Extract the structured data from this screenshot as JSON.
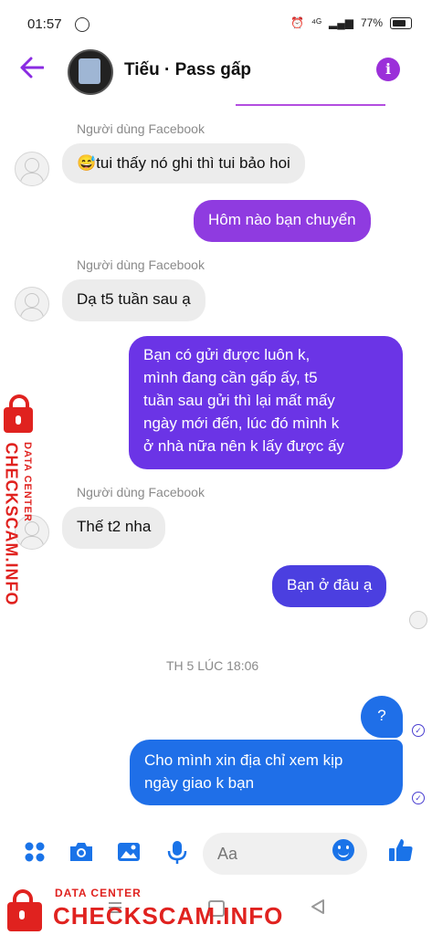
{
  "status_bar": {
    "time": "01:57",
    "signal": "⁴ᴳ",
    "battery": "77%"
  },
  "header": {
    "title": "Tiếu · Pass gấp",
    "info_icon": "i"
  },
  "messages": [
    {
      "sender": "Người dùng Facebook",
      "text": "😅tui thấy nó ghi thì tui bảo hoi"
    },
    {
      "text": "Hôm nào bạn chuyển"
    },
    {
      "sender": "Người dùng Facebook",
      "text": "Dạ t5 tuần sau ạ"
    },
    {
      "lines": [
        "Bạn có gửi được luôn k,",
        "mình đang cần gấp ấy, t5",
        "tuần sau gửi thì lại mất mấy",
        "ngày mới đến, lúc đó mình k",
        "ở nhà nữa nên k lấy được ấy"
      ]
    },
    {
      "sender": "Người dùng Facebook",
      "text": "Thế t2 nha"
    },
    {
      "text": "Bạn ở đâu ạ"
    },
    {
      "timestamp": "TH 5 LÚC 18:06"
    },
    {
      "text": "?"
    },
    {
      "lines": [
        "Cho mình xin địa chỉ xem kịp",
        "ngày giao k bạn"
      ]
    }
  ],
  "composer": {
    "placeholder": "Aa"
  },
  "watermark": {
    "label": "DATA CENTER",
    "site": "CHECKSCAM.INFO"
  },
  "colors": {
    "purple": "#8f3be0",
    "violet": "#6b34e6",
    "indigo": "#4b3fe0",
    "blue": "#1f6fe8",
    "accent": "#1a73e8"
  },
  "icons": [
    "back-arrow-icon",
    "info-icon",
    "apps-icon",
    "camera-icon",
    "image-icon",
    "mic-icon",
    "emoji-icon",
    "like-icon",
    "lock-icon"
  ]
}
